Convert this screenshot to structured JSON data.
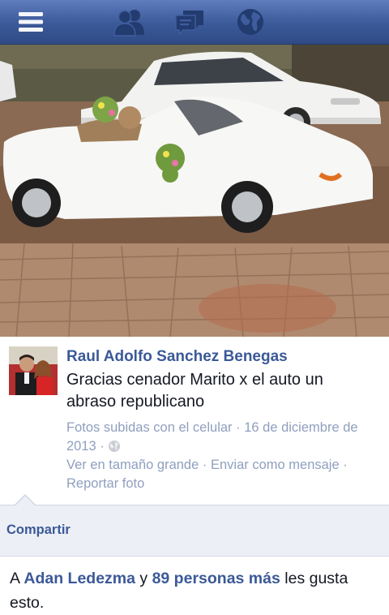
{
  "nav": {
    "icons": [
      "menu-icon",
      "friends-icon",
      "messages-icon",
      "globe-icon"
    ]
  },
  "post": {
    "author": "Raul Adolfo Sanchez Benegas",
    "caption": "Gracias cenador Marito x el auto un abraso republicano",
    "meta": {
      "source": "Fotos subidas con el celular",
      "date": "16 de diciembre de 2013",
      "separator": "·",
      "privacy_icon": "globe-icon",
      "view_large": "Ver en tamaño grande",
      "send_message": "Enviar como mensaje",
      "report": "Reportar foto"
    }
  },
  "share": {
    "label": "Compartir"
  },
  "likes": {
    "prefix": "A",
    "name": "Adan Ledezma",
    "conj": "y",
    "others": "89 personas más",
    "suffix": "les gusta esto."
  },
  "colors": {
    "brand": "#3b5998",
    "link_muted": "#8f9fbf",
    "text": "#141823",
    "share_bg": "#eceff5"
  }
}
